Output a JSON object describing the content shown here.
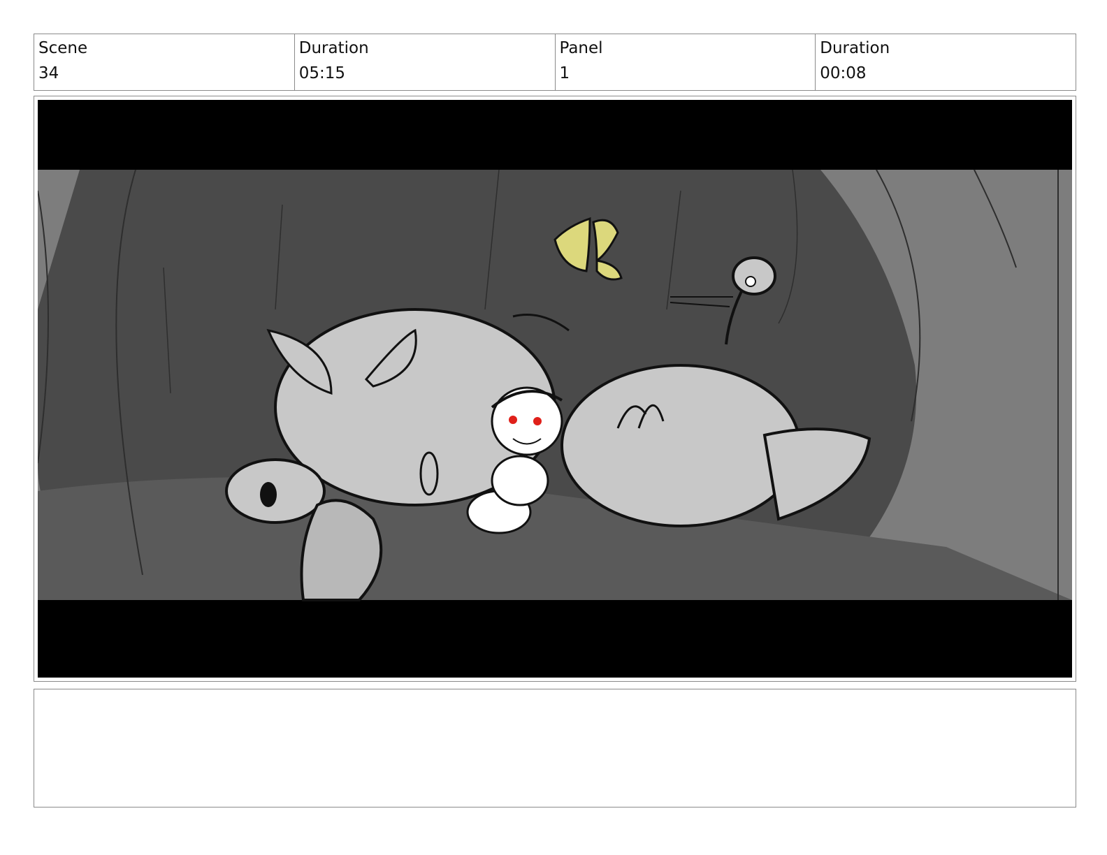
{
  "header": {
    "scene_label": "Scene",
    "scene_value": "34",
    "scene_duration_label": "Duration",
    "scene_duration_value": "05:15",
    "panel_label": "Panel",
    "panel_value": "1",
    "panel_duration_label": "Duration",
    "panel_duration_value": "00:08"
  },
  "notes": {
    "text": ""
  }
}
